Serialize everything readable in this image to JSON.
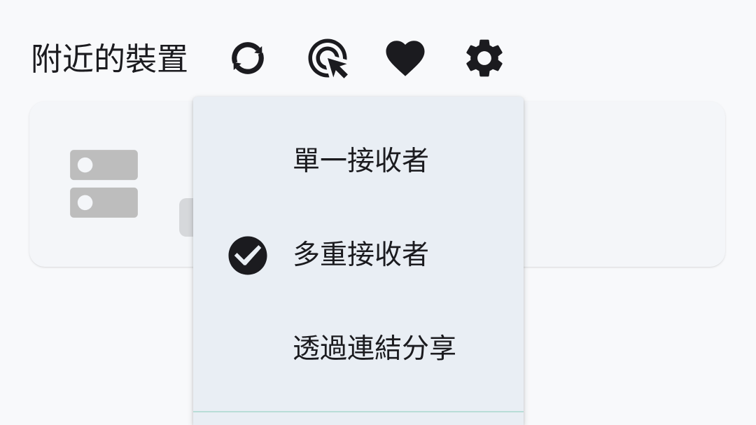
{
  "header": {
    "title": "附近的裝置"
  },
  "toolbar": {
    "actions": [
      {
        "icon": "refresh-icon"
      },
      {
        "icon": "ads-click-icon"
      },
      {
        "icon": "favorite-heart-icon"
      },
      {
        "icon": "settings-gear-icon"
      }
    ]
  },
  "device_card": {
    "icon": "dns-server-icon"
  },
  "send_mode_menu": {
    "items": [
      {
        "label": "單一接收者",
        "checked": false
      },
      {
        "label": "多重接收者",
        "checked": true
      },
      {
        "label": "透過連結分享",
        "checked": false
      }
    ]
  },
  "colors": {
    "page": "#f8f9fb",
    "card": "#f4f6f9",
    "menu": "#e9eef4",
    "ink": "#1b1b1f",
    "placeholder": "#bdbdbd",
    "chip": "#d6d8db",
    "divider": "#b9ddd7"
  }
}
